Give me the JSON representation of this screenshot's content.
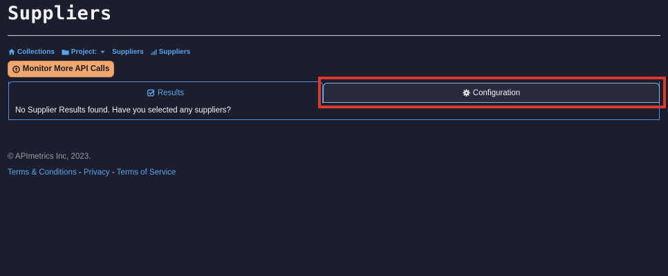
{
  "page": {
    "title": "Suppliers"
  },
  "breadcrumb": {
    "items": [
      {
        "label": "Collections",
        "icon": "home-icon"
      },
      {
        "label": "Project:",
        "icon": "folder-icon",
        "dropdown_value": "Suppliers"
      },
      {
        "label": "Suppliers",
        "icon": "bar-chart-icon"
      }
    ]
  },
  "actions": {
    "monitor_button": "Monitor More API Calls",
    "monitor_icon": "arrow-circle-up-icon"
  },
  "tabs": [
    {
      "label": "Results",
      "icon": "check-square-icon",
      "active": true
    },
    {
      "label": "Configuration",
      "icon": "gear-icon",
      "active": false
    }
  ],
  "results": {
    "empty_message": "No Supplier Results found. Have you selected any suppliers?"
  },
  "footer": {
    "copyright": "© APImetrics Inc, 2023.",
    "links": [
      "Terms & Conditions",
      "Privacy",
      "Terms of Service"
    ],
    "separator": " - "
  },
  "colors": {
    "background": "#1c1e2e",
    "accent": "#5aa5ea",
    "button": "#f0a86e",
    "highlight": "#d83a2c"
  }
}
